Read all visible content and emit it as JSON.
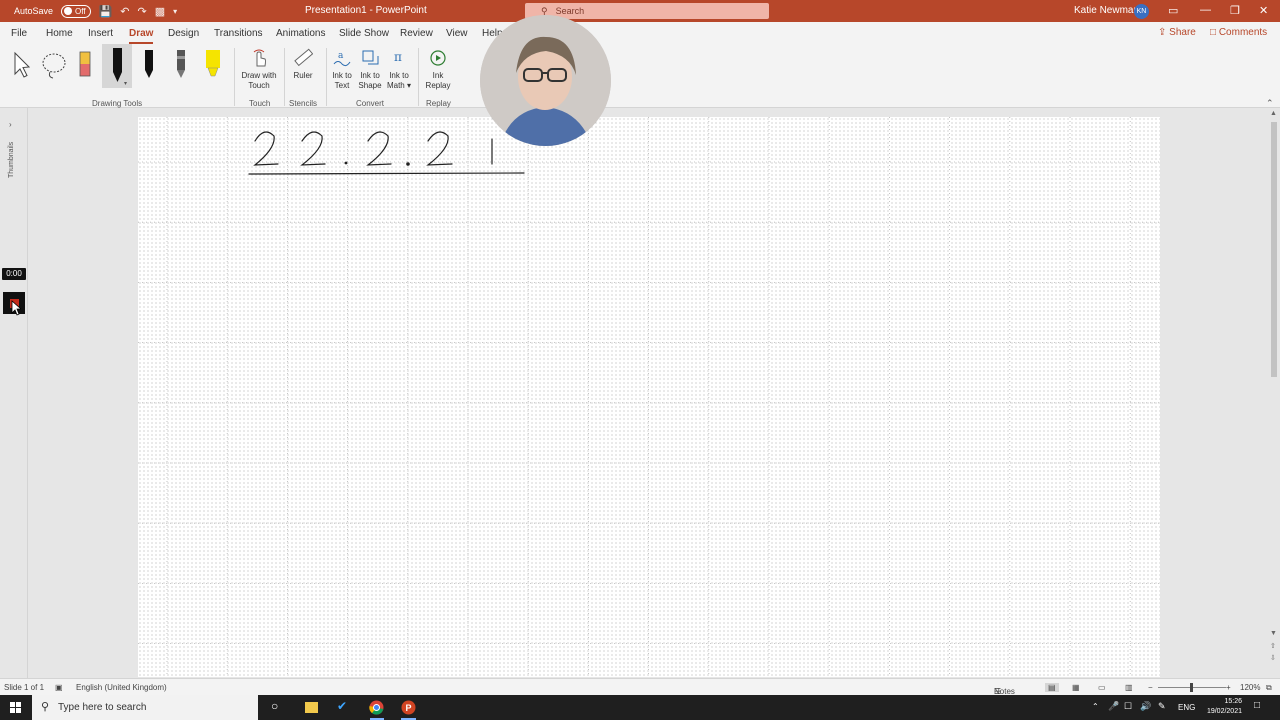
{
  "titlebar": {
    "autosave_label": "AutoSave",
    "autosave_state": "Off",
    "doc_title": "Presentation1 - PowerPoint",
    "search_placeholder": "Search",
    "user_name": "Katie Newman",
    "user_initials": "KN"
  },
  "tabs": [
    "File",
    "Home",
    "Insert",
    "Draw",
    "Design",
    "Transitions",
    "Animations",
    "Slide Show",
    "Review",
    "View",
    "Help"
  ],
  "active_tab": "Draw",
  "actions": {
    "share": "Share",
    "comments": "Comments"
  },
  "ribbon": {
    "groups": {
      "drawing_tools": "Drawing Tools",
      "touch": "Touch",
      "stencils": "Stencils",
      "convert": "Convert",
      "replay": "Replay"
    },
    "buttons": {
      "draw_with_touch_1": "Draw with",
      "draw_with_touch_2": "Touch",
      "ruler": "Ruler",
      "ink_to_text_1": "Ink to",
      "ink_to_text_2": "Text",
      "ink_to_shape_1": "Ink to",
      "ink_to_shape_2": "Shape",
      "ink_to_math_1": "Ink to",
      "ink_to_math_2": "Math",
      "ink_replay_1": "Ink",
      "ink_replay_2": "Replay"
    }
  },
  "left_pane": {
    "thumbnails_label": "Thumbnails",
    "timer": "0:00"
  },
  "slide": {
    "handwriting": [
      "2",
      "2",
      "2",
      "2",
      "1"
    ]
  },
  "statusbar": {
    "slide_info": "Slide 1 of 1",
    "language": "English (United Kingdom)",
    "notes": "Notes",
    "zoom": "120%"
  },
  "taskbar": {
    "search_placeholder": "Type here to search",
    "lang": "ENG",
    "time": "15:26",
    "date": "19/02/2021"
  },
  "colors": {
    "accent": "#b7472a",
    "highlighter": "#f5e400",
    "record": "#c42b1c"
  }
}
